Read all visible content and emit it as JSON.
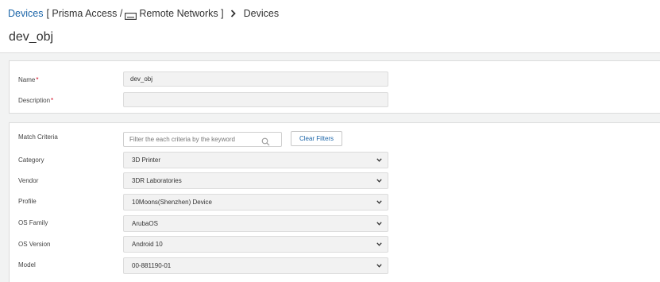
{
  "breadcrumb": {
    "root": "Devices",
    "scope_open": "[ Prisma Access /",
    "scope_icon": "remote-network-icon",
    "scope_item": "Remote Networks ]",
    "separator_icon": "chevron-right-icon",
    "current": "Devices"
  },
  "page": {
    "title": "dev_obj"
  },
  "general": {
    "name_label": "Name",
    "name_value": "dev_obj",
    "description_label": "Description",
    "description_value": "",
    "required_marker": "*"
  },
  "match": {
    "criteria_label": "Match Criteria",
    "search_placeholder": "Filter the each criteria by the keyword",
    "clear_filters_label": "Clear Filters",
    "fields": [
      {
        "label": "Category",
        "value": "3D Printer"
      },
      {
        "label": "Vendor",
        "value": "3DR Laboratories"
      },
      {
        "label": "Profile",
        "value": "10Moons(Shenzhen) Device"
      },
      {
        "label": "OS Family",
        "value": "ArubaOS"
      },
      {
        "label": "OS Version",
        "value": "Android 10"
      },
      {
        "label": "Model",
        "value": "00-881190-01"
      }
    ]
  },
  "colors": {
    "link": "#1a64a8",
    "required": "#d0021b",
    "page_bg": "#f2f3f3",
    "field_bg": "#f2f2f2"
  }
}
